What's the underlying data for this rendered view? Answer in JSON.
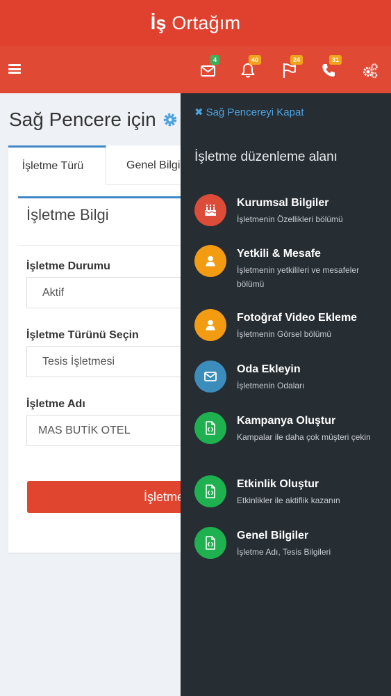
{
  "header": {
    "brand_bold": "İş",
    "brand_rest": " Ortağım"
  },
  "navbar": {
    "menu_icon": "hamburger-menu-icon",
    "icons": [
      {
        "name": "envelope-icon",
        "badge": "4",
        "badge_color": "#3cb15b"
      },
      {
        "name": "bell-icon",
        "badge": "40",
        "badge_color": "#f3a21b"
      },
      {
        "name": "flag-icon",
        "badge": "24",
        "badge_color": "#f3a21b"
      },
      {
        "name": "phone-icon",
        "badge": "31",
        "badge_color": "#f3a21b"
      },
      {
        "name": "cogs-icon",
        "badge": "",
        "badge_color": ""
      }
    ]
  },
  "main": {
    "page_title": "Sağ Pencere için",
    "tabs": [
      {
        "label": "İşletme Türü",
        "active": true
      },
      {
        "label": "Genel Bilgi",
        "active": false
      }
    ],
    "panel_title": "İşletme Bilgi",
    "fields": [
      {
        "label": "İşletme Durumu",
        "value": "Aktif"
      },
      {
        "label": "İşletme Türünü Seçin",
        "value": "Tesis İşletmesi"
      },
      {
        "label": "İşletme Adı",
        "value": "MAS BUTİK OTEL"
      }
    ],
    "submit_label": "İşletme"
  },
  "sidebar": {
    "close_label": "Sağ Pencereyi Kapat",
    "title": "İşletme düzenleme alanı",
    "items": [
      {
        "title": "Kurumsal Bilgiler",
        "subtitle": "İşletmenin Özellikleri bölümü",
        "icon": "birthday-cake-icon",
        "color": "#dd4b39"
      },
      {
        "title": "Yetkili & Mesafe",
        "subtitle": "İşletmenin yetkilileri ve mesafeler bölümü",
        "icon": "user-icon",
        "color": "#f39c12"
      },
      {
        "title": "Fotoğraf Video Ekleme",
        "subtitle": "İşletmenin Görsel bölümü",
        "icon": "user-icon",
        "color": "#f39c12"
      },
      {
        "title": "Oda Ekleyin",
        "subtitle": "İşletmenin Odaları",
        "icon": "envelope-icon",
        "color": "#3c8dbc"
      },
      {
        "title": "Kampanya Oluştur",
        "subtitle": "Kampalar ile daha çok müşteri çekin",
        "icon": "file-code-icon",
        "color": "#1fb150"
      },
      {
        "title": "Etkinlik Oluştur",
        "subtitle": "Etkinlikler ile aktiflik kazanın",
        "icon": "file-code-icon",
        "color": "#1fb150"
      },
      {
        "title": "Genel Bilgiler",
        "subtitle": "İşletme Adı, Tesis Bilgileri",
        "icon": "file-code-icon",
        "color": "#1fb150"
      }
    ]
  }
}
